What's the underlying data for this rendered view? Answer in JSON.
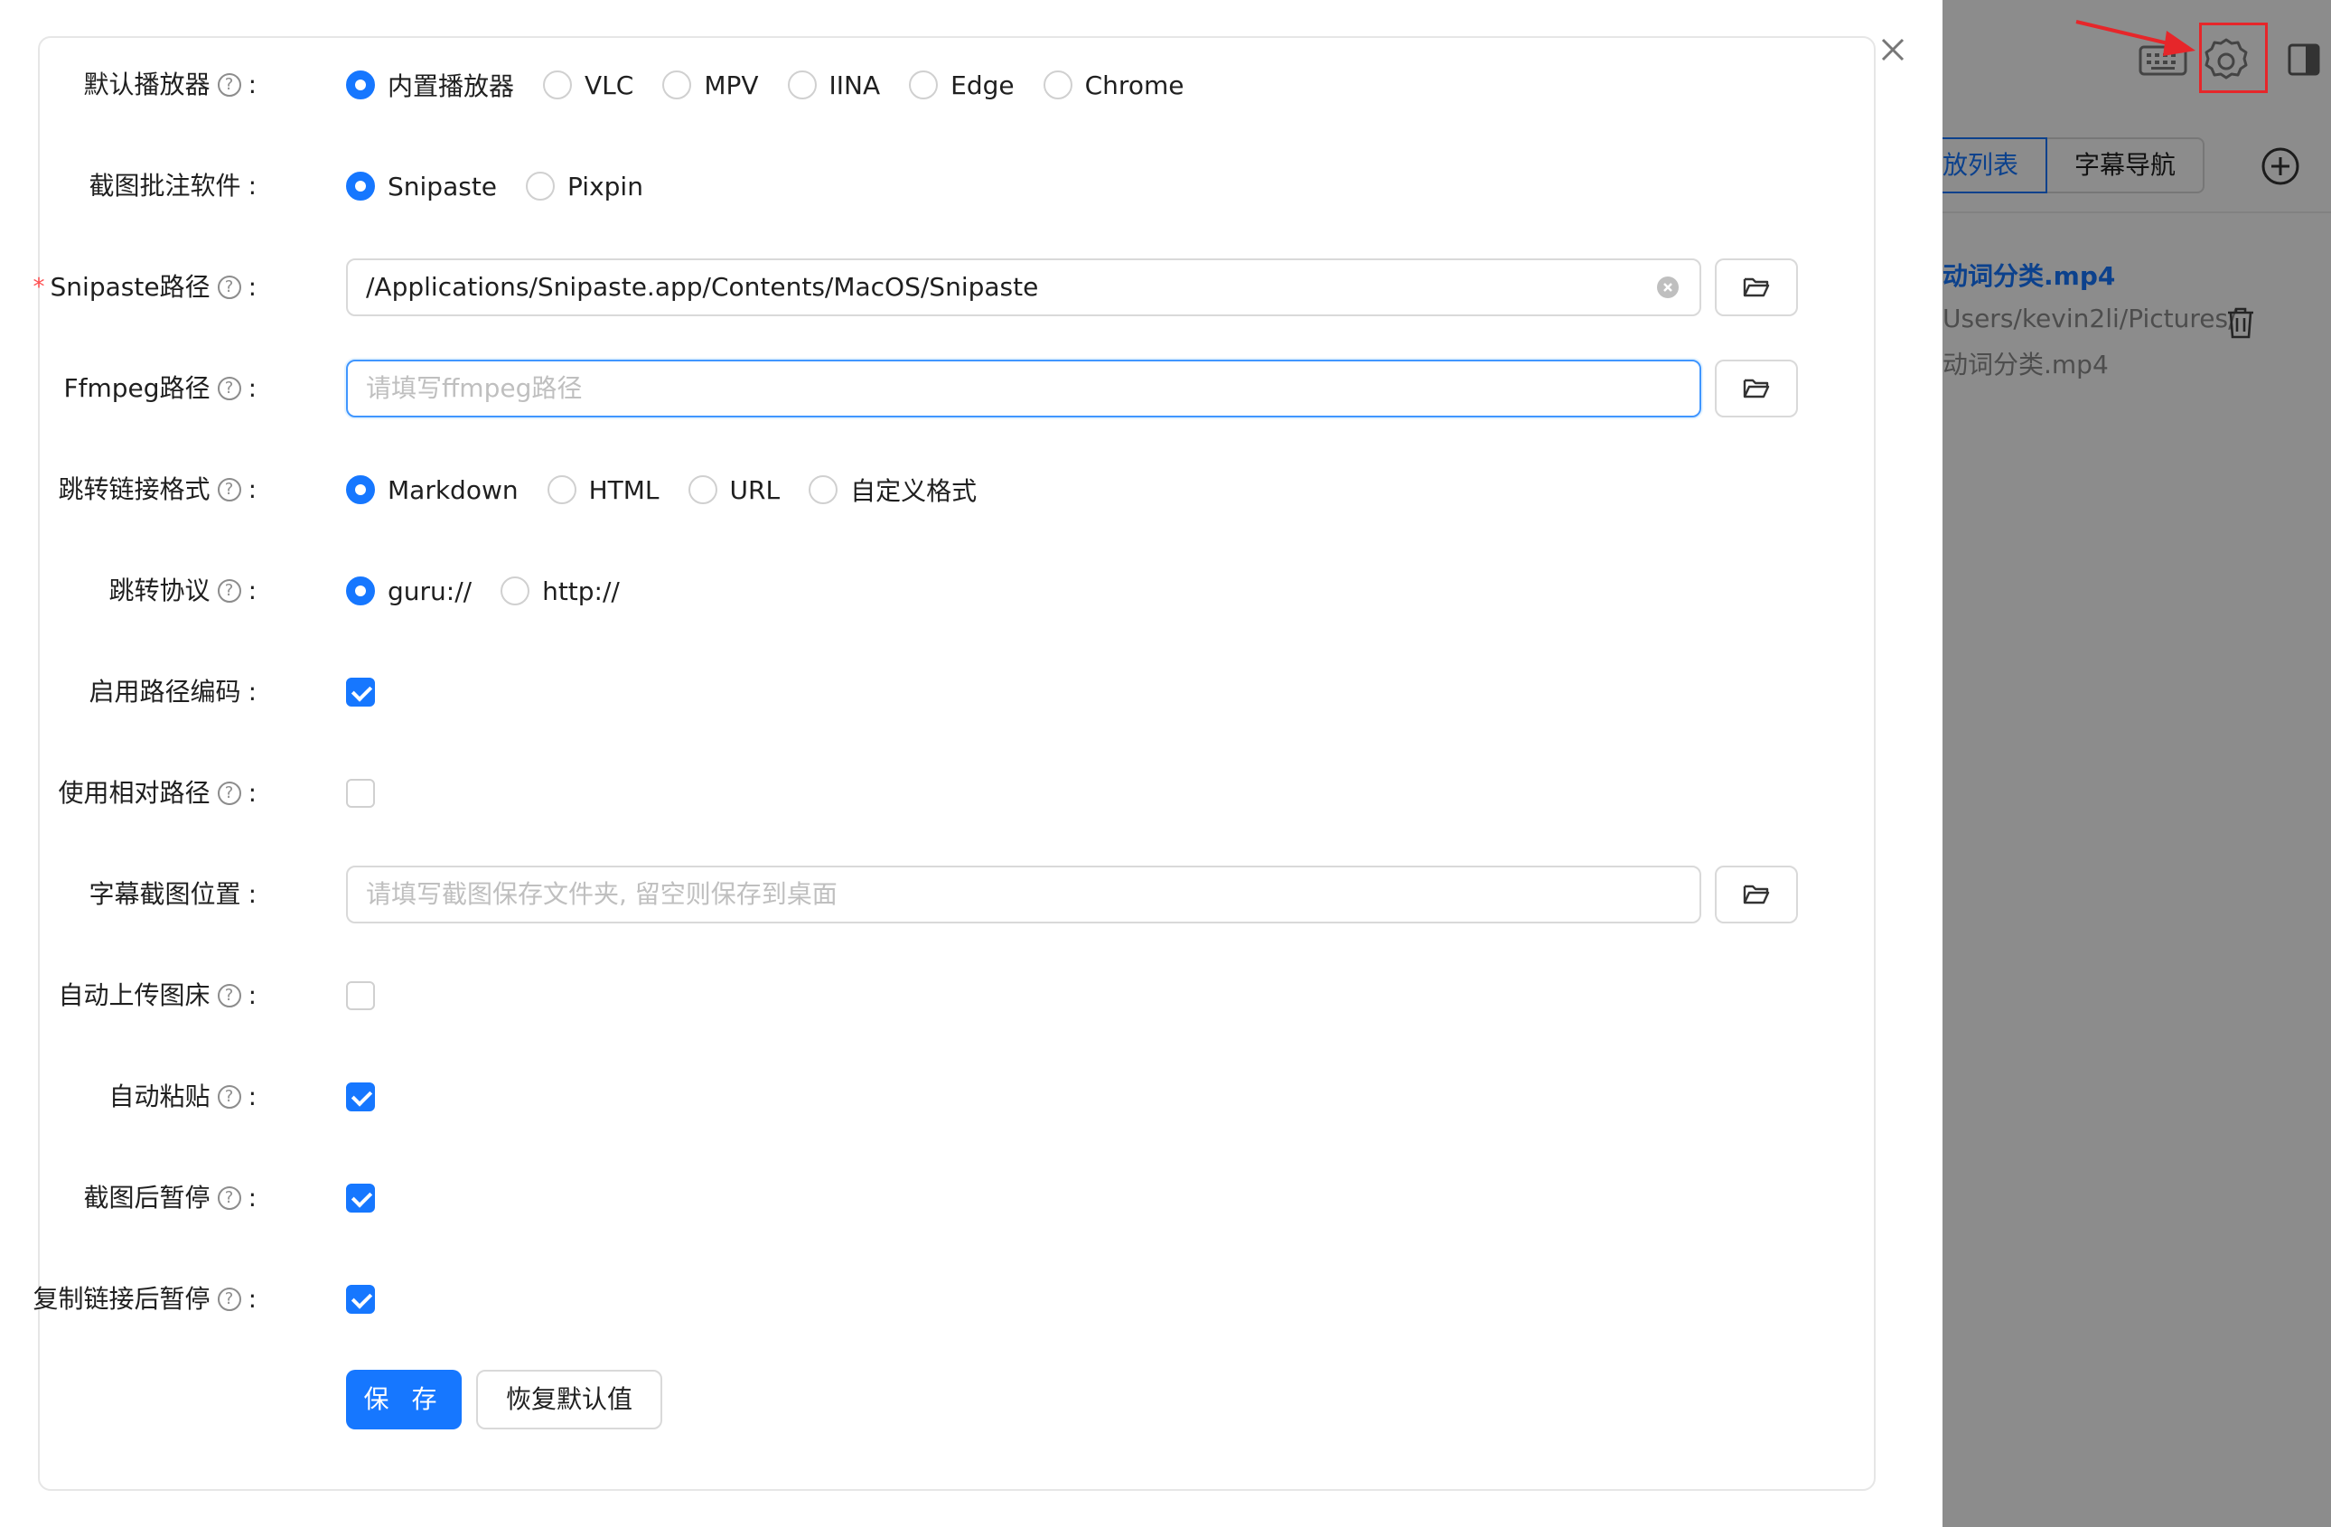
{
  "form": {
    "rows": [
      {
        "label": "默认播放器",
        "help": true,
        "type": "radio",
        "options": [
          "内置播放器",
          "VLC",
          "MPV",
          "IINA",
          "Edge",
          "Chrome"
        ],
        "selected": 0
      },
      {
        "label": "截图批注软件",
        "help": false,
        "type": "radio",
        "options": [
          "Snipaste",
          "Pixpin"
        ],
        "selected": 0
      },
      {
        "label": "Snipaste路径",
        "help": true,
        "required": true,
        "type": "path",
        "value": "/Applications/Snipaste.app/Contents/MacOS/Snipaste",
        "placeholder": ""
      },
      {
        "label": "Ffmpeg路径",
        "help": true,
        "type": "path",
        "value": "",
        "placeholder": "请填写ffmpeg路径",
        "focused": true
      },
      {
        "label": "跳转链接格式",
        "help": true,
        "type": "radio",
        "options": [
          "Markdown",
          "HTML",
          "URL",
          "自定义格式"
        ],
        "selected": 0
      },
      {
        "label": "跳转协议",
        "help": true,
        "type": "radio",
        "options": [
          "guru://",
          "http://"
        ],
        "selected": 0
      },
      {
        "label": "启用路径编码",
        "help": false,
        "type": "checkbox",
        "checked": true
      },
      {
        "label": "使用相对路径",
        "help": true,
        "type": "checkbox",
        "checked": false
      },
      {
        "label": "字幕截图位置",
        "help": false,
        "type": "path",
        "value": "",
        "placeholder": "请填写截图保存文件夹, 留空则保存到桌面"
      },
      {
        "label": "自动上传图床",
        "help": true,
        "type": "checkbox",
        "checked": false
      },
      {
        "label": "自动粘贴",
        "help": true,
        "type": "checkbox",
        "checked": true
      },
      {
        "label": "截图后暂停",
        "help": true,
        "type": "checkbox",
        "checked": true
      },
      {
        "label": "复制链接后暂停",
        "help": true,
        "type": "checkbox",
        "checked": true
      }
    ],
    "help_glyph": "?",
    "colon": ":",
    "required_mark": "*",
    "save_label": "保 存",
    "reset_label": "恢复默认值"
  },
  "background_app": {
    "tabs": [
      "放列表",
      "字幕导航"
    ],
    "active_tab": 0,
    "file_title": "动词分类.mp4",
    "file_path_line1": "Users/kevin2li/Pictures/",
    "file_path_line2": "动词分类.mp4"
  },
  "colors": {
    "primary": "#1677ff",
    "highlight": "#e6262a",
    "required": "#ff4d4f"
  },
  "icons": {
    "close": "close-icon",
    "folder": "folder-open-icon",
    "clear": "clear-circle-icon",
    "settings": "gear-icon",
    "keyboard": "keyboard-icon",
    "panel": "side-panel-icon",
    "add": "plus-circle-icon",
    "trash": "trash-icon"
  }
}
